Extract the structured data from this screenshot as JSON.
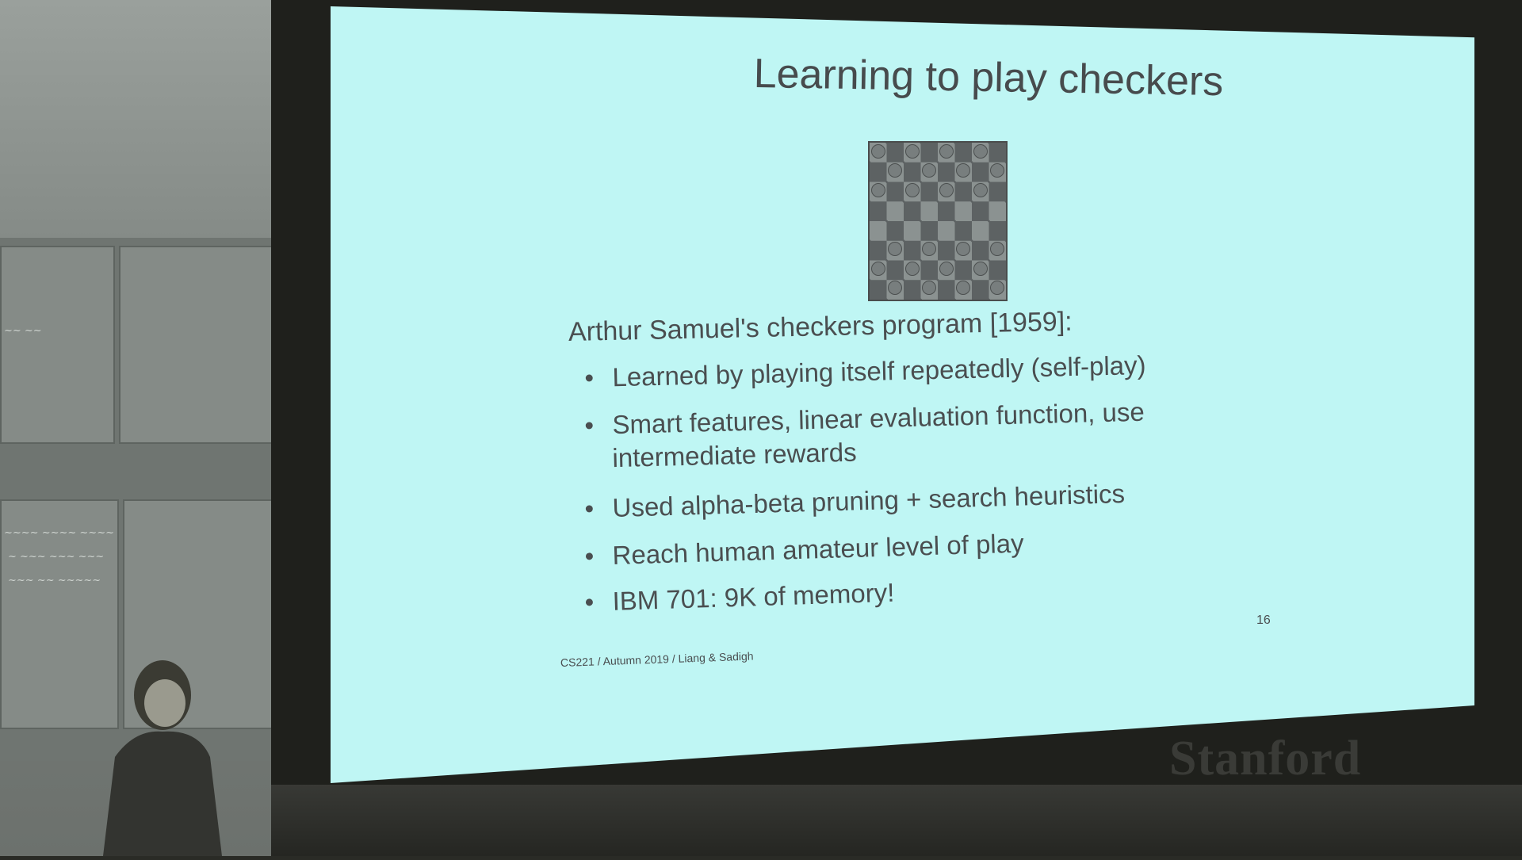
{
  "slide": {
    "title": "Learning to play checkers",
    "intro": "Arthur Samuel's checkers program [1959]:",
    "bullets": [
      {
        "text": "Learned by playing itself repeatedly (self-play)"
      },
      {
        "text": "Smart features, linear evaluation function, use"
      },
      {
        "text": "intermediate rewards"
      },
      {
        "text": "Used alpha-beta pruning + search heuristics"
      },
      {
        "text": "Reach human amateur level of play"
      },
      {
        "text": "IBM 701: 9K of memory!"
      }
    ],
    "bullet_glyph": "•",
    "page_number": "16",
    "footer": "CS221 / Autumn 2019 / Liang & Sadigh"
  },
  "room": {
    "wall_text": "Stanford"
  },
  "colors": {
    "slide_background": "#bff6f4",
    "slide_text": "#4a4e50",
    "room_wall": "#858b87"
  },
  "icons": {
    "checkerboard": "checkerboard-image"
  }
}
